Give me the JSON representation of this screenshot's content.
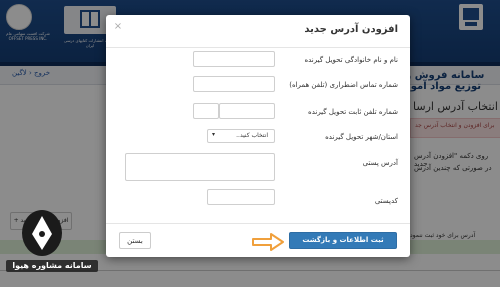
{
  "background": {
    "left_logo_caption": "شرکت افست سهامی عام OFFSET PRESS INC.",
    "middle_logo_caption": "شرکت انتشارات کتابهای درسی ایران",
    "site_title": "سامانه فروش و توزیع مواد آموز",
    "nav_item": "خروج ‹ لاگین",
    "page_title": "انتخاب آدرس ارسا",
    "alert_text": "برای افزودن و انتخاب آدرس جد",
    "bullet1": "روی دکمه \"افزودن آدرس جدید",
    "bullet2": "در صورتی که چندین آدرس",
    "add_button": "+ افزودن آدرس جدید",
    "bottom_text": "آدرس برای خود ثبت ننمود",
    "watermark_text": "سامانه مشاوره هیوا"
  },
  "modal": {
    "title": "افزودن آدرس جدید",
    "close_glyph": "×",
    "fields": {
      "name_label": "نام و نام خانوادگی تحویل گیرنده",
      "mobile_label": "شماره تماس اضطراری (تلفن همراه)",
      "phone_label": "شماره تلفن ثابت تحویل گیرنده",
      "province_label": "استان/شهر تحویل گیرنده",
      "province_select": "انتخاب کنید..",
      "address_label": "آدرس پستی",
      "postal_label": "کدپستی"
    },
    "close_button": "بستن",
    "submit_button": "ثبت اطلاعات و بازگشت"
  },
  "colors": {
    "header_blue": "#1f4f8e",
    "primary_button": "#337ab7",
    "arrow_orange": "#f0a03c"
  }
}
